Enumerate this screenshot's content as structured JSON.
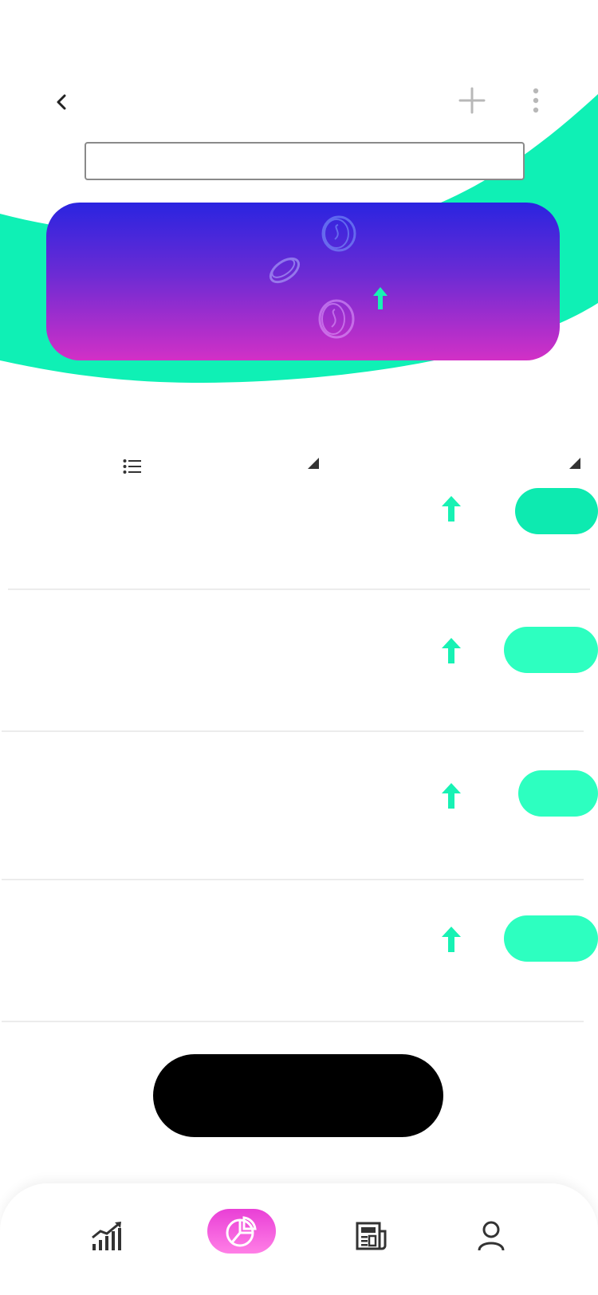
{
  "colors": {
    "accent_green": "#0ff0b5",
    "pill_green_1": "#0deab0",
    "pill_green_2": "#2dffc0",
    "hero_top": "#2a24e0",
    "hero_bottom": "#d230c6",
    "nav_active": "#ee4fdc",
    "main_button": "#000000"
  },
  "header": {
    "back_icon": "chevron-left-icon",
    "add_icon": "plus-icon",
    "more_icon": "more-vertical-icon",
    "search_value": "",
    "search_placeholder": ""
  },
  "hero": {
    "decorations": [
      "coin-icon",
      "coin-icon",
      "coin-icon",
      "arrow-up-icon"
    ]
  },
  "table": {
    "list_icon": "list-icon",
    "sort_icons": [
      "sort-corner-icon",
      "sort-corner-icon"
    ]
  },
  "rows": [
    {
      "trend_icon": "arrow-up-icon",
      "pill_color": "#0deab0"
    },
    {
      "trend_icon": "arrow-up-icon",
      "pill_color": "#2dffc0"
    },
    {
      "trend_icon": "arrow-up-icon",
      "pill_color": "#2dffc0"
    },
    {
      "trend_icon": "arrow-up-icon",
      "pill_color": "#2dffc0"
    }
  ],
  "main_action": {
    "label": ""
  },
  "bottom_nav": {
    "items": [
      {
        "icon": "market-chart-icon",
        "active": false
      },
      {
        "icon": "pie-chart-icon",
        "active": true
      },
      {
        "icon": "news-icon",
        "active": false
      },
      {
        "icon": "user-icon",
        "active": false
      }
    ]
  }
}
